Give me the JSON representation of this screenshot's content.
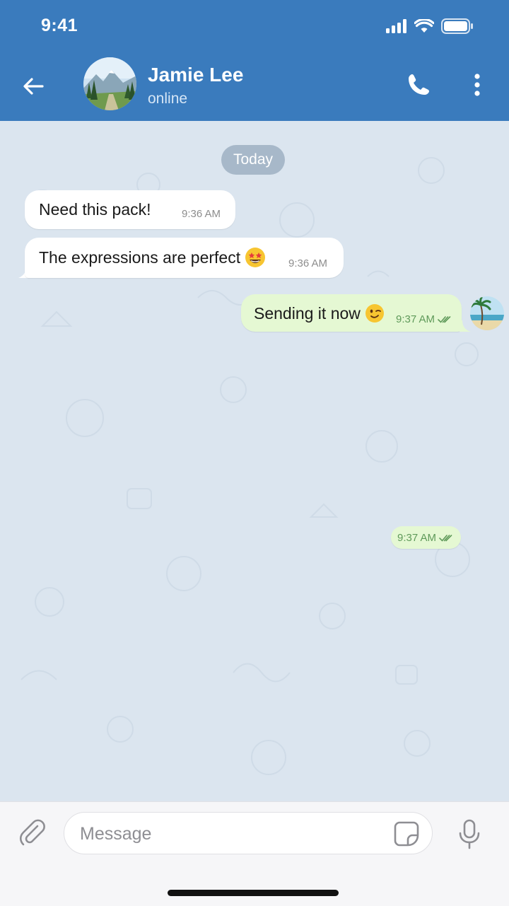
{
  "status_bar": {
    "time": "9:41"
  },
  "header": {
    "contact_name": "Jamie Lee",
    "contact_status": "online",
    "icons": [
      "back-arrow-icon",
      "phone-icon",
      "more-vertical-icon"
    ]
  },
  "chat": {
    "date_chip": "Today",
    "messages": [
      {
        "direction": "in",
        "text": "Need this pack!",
        "time": "9:36 AM"
      },
      {
        "direction": "in",
        "text": "The expressions are perfect",
        "emoji": "star-struck-emoji",
        "time": "9:36 AM"
      },
      {
        "direction": "out",
        "text": "Sending it now",
        "emoji": "winking-face-emoji",
        "time": "9:37 AM",
        "read": true
      },
      {
        "direction": "out",
        "text": "",
        "time": "9:37 AM",
        "read": true
      }
    ]
  },
  "composer": {
    "placeholder": "Message",
    "value": "",
    "icons": [
      "paperclip-icon",
      "sticker-icon",
      "microphone-icon"
    ]
  },
  "colors": {
    "header": "#3a7bbd",
    "chat_background": "#dbe5ef",
    "incoming_bubble": "#ffffff",
    "outgoing_bubble": "#e5f8d3",
    "read_checks": "#5f9a5a"
  }
}
